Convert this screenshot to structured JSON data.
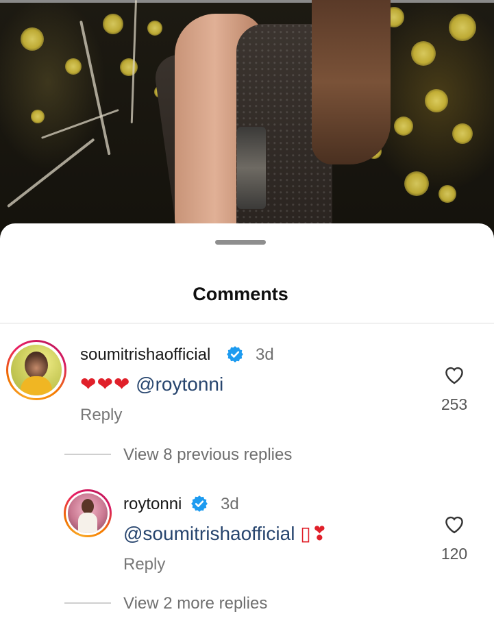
{
  "sheet": {
    "title": "Comments"
  },
  "comments": [
    {
      "username": "soumitrishaofficial",
      "verified": true,
      "time": "3d",
      "hearts": "❤❤❤",
      "mention": "@roytonni",
      "reply_label": "Reply",
      "like_count": "253",
      "view_replies": "View 8 previous replies"
    },
    {
      "username": "roytonni",
      "verified": true,
      "time": "3d",
      "mention": "@soumitrishaofficial",
      "suffix": "▯❣",
      "reply_label": "Reply",
      "like_count": "120",
      "view_replies": "View 2 more replies"
    }
  ],
  "colors": {
    "mention": "#27456e",
    "verified": "#1d9bf0",
    "heart": "#e0202a"
  }
}
